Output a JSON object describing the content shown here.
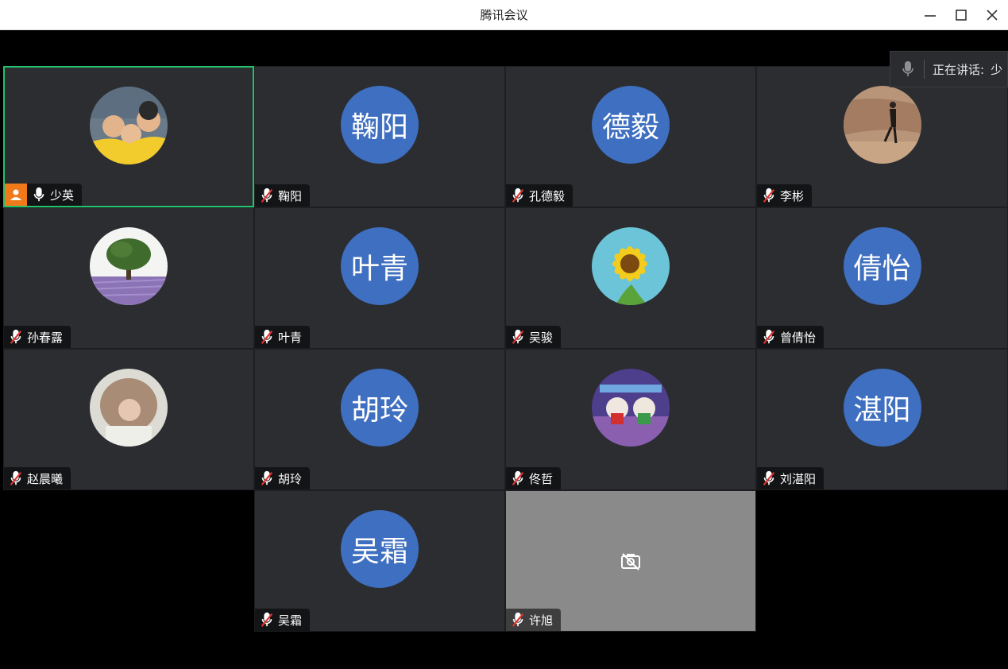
{
  "window": {
    "title": "腾讯会议"
  },
  "speaking": {
    "label": "正在讲话:",
    "name": "少"
  },
  "participants": [
    {
      "name": "少英",
      "avatar_type": "photo",
      "photo": "family-photo",
      "mic": "on",
      "host": true,
      "active": true
    },
    {
      "name": "鞠阳",
      "avatar_type": "text",
      "avatar_text": "鞠阳",
      "mic": "muted"
    },
    {
      "name": "孔德毅",
      "avatar_type": "text",
      "avatar_text": "德毅",
      "mic": "muted"
    },
    {
      "name": "李彬",
      "avatar_type": "photo",
      "photo": "person-walking-photo",
      "mic": "muted"
    },
    {
      "name": "孙春露",
      "avatar_type": "photo",
      "photo": "tree-lavender-photo",
      "mic": "muted"
    },
    {
      "name": "叶青",
      "avatar_type": "text",
      "avatar_text": "叶青",
      "mic": "muted"
    },
    {
      "name": "吴骏",
      "avatar_type": "photo",
      "photo": "sunflower-photo",
      "mic": "muted"
    },
    {
      "name": "曾倩怡",
      "avatar_type": "text",
      "avatar_text": "倩怡",
      "mic": "muted"
    },
    {
      "name": "赵晨曦",
      "avatar_type": "photo",
      "photo": "girl-photo",
      "mic": "muted"
    },
    {
      "name": "胡玲",
      "avatar_type": "text",
      "avatar_text": "胡玲",
      "mic": "muted"
    },
    {
      "name": "佟哲",
      "avatar_type": "photo",
      "photo": "cartoon-photo",
      "mic": "muted"
    },
    {
      "name": "刘湛阳",
      "avatar_type": "text",
      "avatar_text": "湛阳",
      "mic": "muted"
    },
    {
      "name": "吴霜",
      "avatar_type": "text",
      "avatar_text": "吴霜",
      "mic": "muted"
    },
    {
      "name": "许旭",
      "avatar_type": "camera-off",
      "mic": "muted"
    }
  ],
  "colors": {
    "accent_green": "#22c36b",
    "avatar_blue": "#3f6fc0",
    "tile_bg": "#2b2d31",
    "host_orange": "#f07a1a",
    "mute_red": "#e0322f"
  }
}
